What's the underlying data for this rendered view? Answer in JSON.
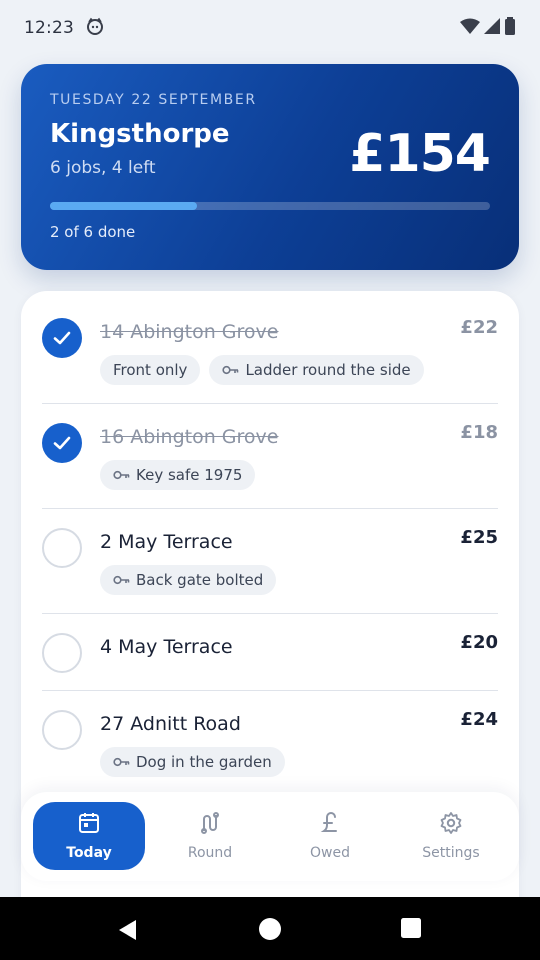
{
  "status_bar": {
    "time": "12:23",
    "icons": [
      "debug-icon",
      "wifi-icon",
      "signal-icon",
      "battery-icon"
    ]
  },
  "summary": {
    "date": "TUESDAY 22 SEPTEMBER",
    "area": "Kingsthorpe",
    "jobs_left": "6 jobs, 4 left",
    "total": "£154",
    "progress_fraction": 0.333,
    "progress_text": "2 of 6 done",
    "colors": {
      "card_start": "#1a5cc0",
      "card_end": "#082f78",
      "progress_fill": "#5aaaf2"
    }
  },
  "jobs": [
    {
      "address": "14 Abington Grove",
      "price": "£22",
      "done": true,
      "chips": [
        {
          "icon": "",
          "label": "Front only"
        },
        {
          "icon": "key-icon",
          "label": "Ladder round the side"
        }
      ]
    },
    {
      "address": "16 Abington Grove",
      "price": "£18",
      "done": true,
      "chips": [
        {
          "icon": "key-icon",
          "label": "Key safe 1975"
        }
      ]
    },
    {
      "address": "2 May Terrace",
      "price": "£25",
      "done": false,
      "chips": [
        {
          "icon": "key-icon",
          "label": "Back gate bolted"
        }
      ]
    },
    {
      "address": "4 May Terrace",
      "price": "£20",
      "done": false,
      "chips": []
    },
    {
      "address": "27 Adnitt Road",
      "price": "£24",
      "done": false,
      "chips": [
        {
          "icon": "key-icon",
          "label": "Dog in the garden"
        }
      ]
    }
  ],
  "nav": {
    "items": [
      {
        "label": "Today",
        "icon": "calendar-icon",
        "active": true
      },
      {
        "label": "Round",
        "icon": "route-icon",
        "active": false
      },
      {
        "label": "Owed",
        "icon": "pound-icon",
        "active": false
      },
      {
        "label": "Settings",
        "icon": "gear-icon",
        "active": false
      }
    ]
  },
  "system_nav": [
    "back-icon",
    "home-icon",
    "recents-icon"
  ],
  "accent": "#1760cc"
}
